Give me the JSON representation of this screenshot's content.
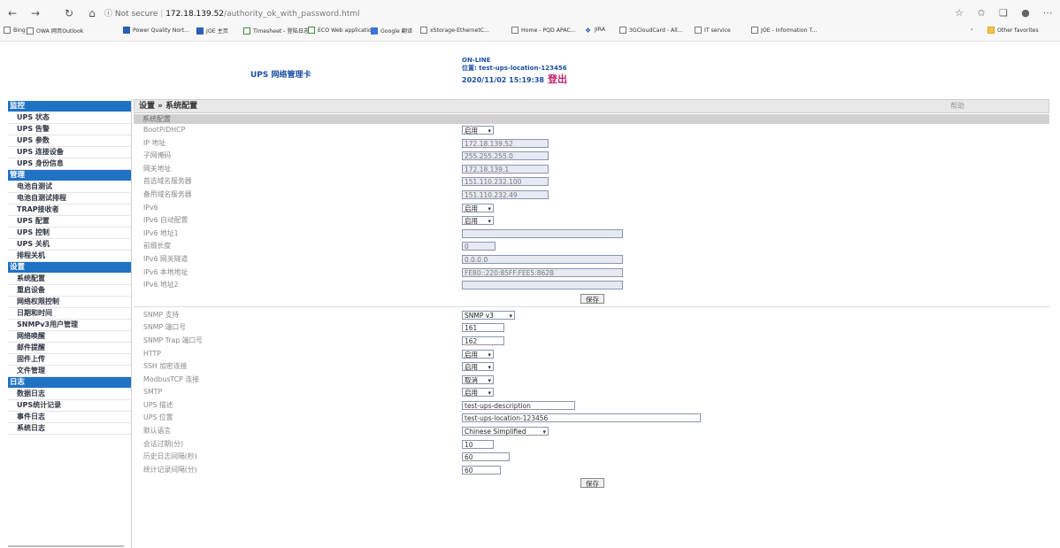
{
  "browser": {
    "back_icon": "back-arrow-icon",
    "url_prefix": "ⓘ Not secure",
    "url_host": "172.18.139.52",
    "url_path": "/authority_ok_with_password.html",
    "favorites": [
      {
        "label": "Bing",
        "icon": "page-icon"
      },
      {
        "label": "OWA 网页Outlook",
        "icon": "page-icon"
      },
      {
        "label": "Power Quality Nort...",
        "icon": "ms-icon"
      },
      {
        "label": "JOE 主页",
        "icon": "ms-icon"
      },
      {
        "label": "Timesheet - 登陆日志",
        "icon": "tb-icon"
      },
      {
        "label": "ECO Web application",
        "icon": "tb-icon"
      },
      {
        "label": "Google 翻译",
        "icon": "google-icon"
      },
      {
        "label": "xStorage-EthernetC...",
        "icon": "page-icon"
      },
      {
        "label": "Home - PQD APAC...",
        "icon": "page-icon"
      },
      {
        "label": "JIRA",
        "icon": "jira-icon"
      },
      {
        "label": "3GCloudCard - All...",
        "icon": "page-icon"
      },
      {
        "label": "IT service",
        "icon": "page-icon"
      },
      {
        "label": "JOE - Information T...",
        "icon": "page-icon"
      }
    ],
    "other_favorites": "Other favorites"
  },
  "header": {
    "title": "UPS 网络管理卡",
    "status": "ON-LINE",
    "location": "位置: test-ups-location-123456",
    "datetime": "2020/11/02 15:19:38",
    "logout": "登出"
  },
  "sidebar": {
    "sections": [
      {
        "title": "监控",
        "items": [
          "UPS 状态",
          "UPS 告警",
          "UPS 参数",
          "UPS 连接设备",
          "UPS 身份信息"
        ]
      },
      {
        "title": "管理",
        "items": [
          "电池自测试",
          "电池自测试排程",
          "TRAP接收者",
          "UPS 配置",
          "UPS 控制",
          "UPS 关机",
          "排程关机"
        ]
      },
      {
        "title": "设置",
        "items": [
          "系统配置",
          "重启设备",
          "网络权限控制",
          "日期和时间",
          "SNMPv3用户管理",
          "网络唤醒",
          "邮件提醒",
          "固件上传",
          "文件管理"
        ]
      },
      {
        "title": "日志",
        "items": [
          "数据日志",
          "UPS统计记录",
          "事件日志",
          "系统日志"
        ]
      }
    ]
  },
  "main": {
    "breadcrumb": "设置 » 系统配置",
    "help": "帮助",
    "section_title": "系统配置",
    "group1": [
      {
        "label": "BootP/DHCP",
        "value": "启用",
        "type": "select",
        "w": 36
      },
      {
        "label": "IP 地址",
        "value": "172.18.139.52",
        "type": "input",
        "w": 98
      },
      {
        "label": "子网掩码",
        "value": "255.255.255.0",
        "type": "input",
        "w": 98
      },
      {
        "label": "网关地址",
        "value": "172.18.139.1",
        "type": "input",
        "w": 98
      },
      {
        "label": "首选域名服务器",
        "value": "151.110.232.100",
        "type": "input",
        "w": 98
      },
      {
        "label": "备用域名服务器",
        "value": "151.110.232.49",
        "type": "input",
        "w": 98
      },
      {
        "label": "IPv6",
        "value": "启用",
        "type": "select",
        "w": 36
      },
      {
        "label": "IPv6 自动配置",
        "value": "启用",
        "type": "select",
        "w": 36
      },
      {
        "label": "IPv6 地址1",
        "value": "",
        "type": "input",
        "w": 182
      },
      {
        "label": "前缀长度",
        "value": "0",
        "type": "input",
        "w": 38
      },
      {
        "label": "IPv6 网关隧道",
        "value": "0.0.0.0",
        "type": "input",
        "w": 182
      },
      {
        "label": "IPv6 本地地址",
        "value": "FE80::220:85FF:FEE5:862B",
        "type": "input",
        "w": 182
      },
      {
        "label": "IPv6 地址2",
        "value": "",
        "type": "input",
        "w": 182
      }
    ],
    "save1": "保存",
    "group2": [
      {
        "label": "SNMP 支持",
        "value": "SNMP v3",
        "type": "select",
        "w": 60
      },
      {
        "label": "SNMP 端口号",
        "value": "161",
        "type": "input-bright",
        "w": 48
      },
      {
        "label": "SNMP Trap 端口号",
        "value": "162",
        "type": "input-bright",
        "w": 48
      },
      {
        "label": "HTTP",
        "value": "启用",
        "type": "select",
        "w": 36
      },
      {
        "label": "SSH 加密连接",
        "value": "启用",
        "type": "select",
        "w": 36
      },
      {
        "label": "ModbusTCP 连接",
        "value": "取消",
        "type": "select",
        "w": 36
      },
      {
        "label": "SMTP",
        "value": "启用",
        "type": "select",
        "w": 36
      },
      {
        "label": "UPS 描述",
        "value": "test-ups-description",
        "type": "input-bright",
        "w": 128
      },
      {
        "label": "UPS 位置",
        "value": "test-ups-location-123456",
        "type": "input-bright",
        "w": 270
      },
      {
        "label": "默认语言",
        "value": "Chinese Simplified",
        "type": "select",
        "w": 98
      },
      {
        "label": "会话过期(分)",
        "value": "10",
        "type": "input-bright",
        "w": 36
      },
      {
        "label": "历史日志间隔(秒)",
        "value": "60",
        "type": "input-bright",
        "w": 54
      },
      {
        "label": "统计记录间隔(分)",
        "value": "60",
        "type": "input-bright",
        "w": 44
      }
    ],
    "save2": "保存"
  }
}
